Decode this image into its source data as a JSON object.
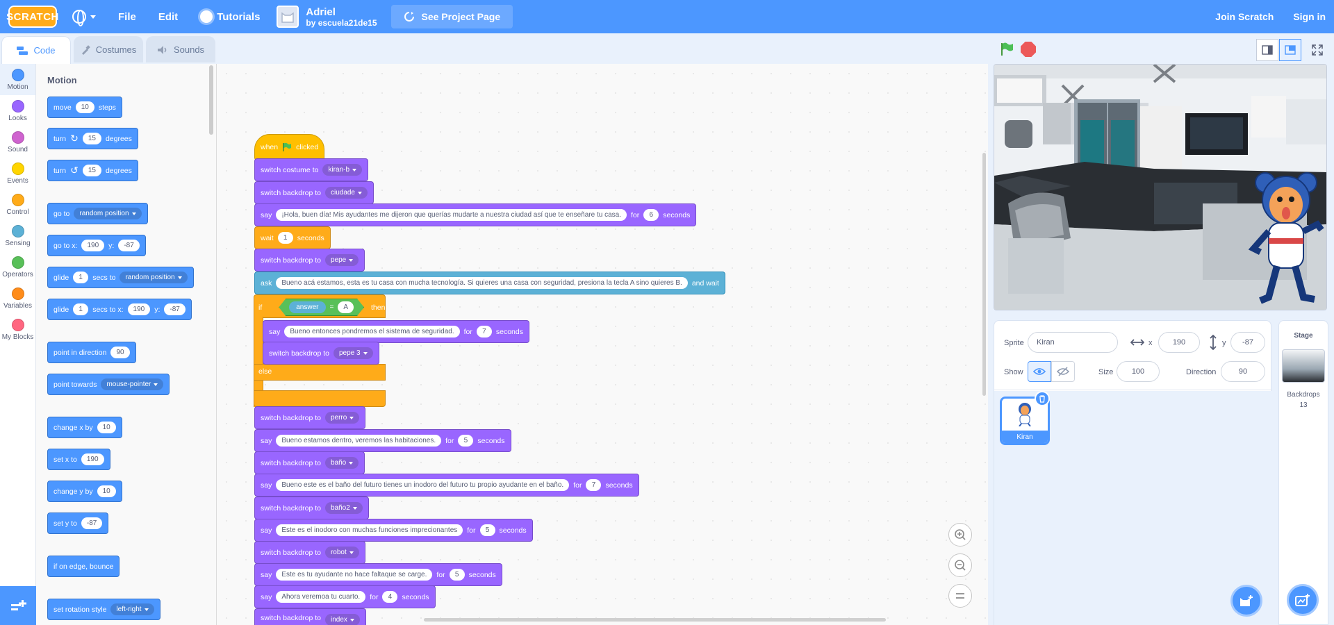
{
  "menubar": {
    "logo": "SCRATCH",
    "file": "File",
    "edit": "Edit",
    "tutorials": "Tutorials",
    "project_title": "Adriel",
    "project_author": "by escuela21de15",
    "see_project": "See Project Page",
    "join": "Join Scratch",
    "signin": "Sign in"
  },
  "tabs": {
    "code": "Code",
    "costumes": "Costumes",
    "sounds": "Sounds"
  },
  "categories": [
    {
      "label": "Motion",
      "color": "#4c97ff"
    },
    {
      "label": "Looks",
      "color": "#9966ff"
    },
    {
      "label": "Sound",
      "color": "#cf63cf"
    },
    {
      "label": "Events",
      "color": "#ffd500"
    },
    {
      "label": "Control",
      "color": "#ffab19"
    },
    {
      "label": "Sensing",
      "color": "#5cb1d6"
    },
    {
      "label": "Operators",
      "color": "#59c059"
    },
    {
      "label": "Variables",
      "color": "#ff8c1a"
    },
    {
      "label": "My Blocks",
      "color": "#ff6680"
    }
  ],
  "palette": {
    "title": "Motion",
    "move": {
      "a": "move",
      "v": "10",
      "b": "steps"
    },
    "turn_right": {
      "a": "turn",
      "v": "15",
      "b": "degrees"
    },
    "turn_left": {
      "a": "turn",
      "v": "15",
      "b": "degrees"
    },
    "goto": {
      "a": "go to",
      "d": "random position"
    },
    "gotoxy": {
      "a": "go to x:",
      "x": "190",
      "b": "y:",
      "y": "-87"
    },
    "glide_to": {
      "a": "glide",
      "v": "1",
      "b": "secs to",
      "d": "random position"
    },
    "glide_xy": {
      "a": "glide",
      "v": "1",
      "b": "secs to x:",
      "x": "190",
      "c": "y:",
      "y": "-87"
    },
    "point_dir": {
      "a": "point in direction",
      "v": "90"
    },
    "point_towards": {
      "a": "point towards",
      "d": "mouse-pointer"
    },
    "change_x": {
      "a": "change x by",
      "v": "10"
    },
    "set_x": {
      "a": "set x to",
      "v": "190"
    },
    "change_y": {
      "a": "change y by",
      "v": "10"
    },
    "set_y": {
      "a": "set y to",
      "v": "-87"
    },
    "bounce": {
      "a": "if on edge, bounce"
    },
    "rot_style": {
      "a": "set rotation style",
      "d": "left-right"
    }
  },
  "script": {
    "when_flag": {
      "a": "when",
      "b": "clicked"
    },
    "b1": {
      "a": "switch costume to",
      "d": "kiran-b"
    },
    "b2": {
      "a": "switch backdrop to",
      "d": "ciudade"
    },
    "b3": {
      "a": "say",
      "msg": "¡Hola, buen día! Mis ayudantes me dijeron que querías mudarte a nuestra ciudad así que te enseñare tu casa.",
      "for": "for",
      "v": "6",
      "b": "seconds"
    },
    "b4": {
      "a": "wait",
      "v": "1",
      "b": "seconds"
    },
    "b5": {
      "a": "switch backdrop to",
      "d": "pepe"
    },
    "b6": {
      "a": "ask",
      "msg": "Bueno acá estamos, esta  es tu casa con mucha tecnología. Si quieres una casa con seguridad, presiona la tecla  A sino quieres B.",
      "b": "and wait"
    },
    "if": {
      "a": "if",
      "answer": "answer",
      "eq": "=",
      "v": "A",
      "then": "then",
      "else": "else"
    },
    "b7": {
      "a": "say",
      "msg": "Bueno entonces pondremos el sistema de seguridad.",
      "for": "for",
      "v": "7",
      "b": "seconds"
    },
    "b8": {
      "a": "switch backdrop to",
      "d": "pepe 3"
    },
    "b9": {
      "a": "switch backdrop to",
      "d": "perro"
    },
    "b10": {
      "a": "say",
      "msg": "Bueno estamos dentro, veremos las habitaciones.",
      "for": "for",
      "v": "5",
      "b": "seconds"
    },
    "b11": {
      "a": "switch backdrop to",
      "d": "baño"
    },
    "b12": {
      "a": "say",
      "msg": "Bueno este es el baño del futuro tienes un inodoro del futuro tu propio ayudante en el baño.",
      "for": "for",
      "v": "7",
      "b": "seconds"
    },
    "b13": {
      "a": "switch backdrop to",
      "d": "baño2"
    },
    "b14": {
      "a": "say",
      "msg": "Este es el inodoro con muchas funciones imprecionantes",
      "for": "for",
      "v": "5",
      "b": "seconds"
    },
    "b15": {
      "a": "switch backdrop to",
      "d": "robot"
    },
    "b16": {
      "a": "say",
      "msg": "Este es tu ayudante no hace faltaque se carge.",
      "for": "for",
      "v": "5",
      "b": "seconds"
    },
    "b17": {
      "a": "say",
      "msg": "Ahora veremoa tu cuarto.",
      "for": "for",
      "v": "4",
      "b": "seconds"
    },
    "b18": {
      "a": "switch backdrop to",
      "d": "index"
    }
  },
  "sprite_info": {
    "sprite_label": "Sprite",
    "sprite_name": "Kiran",
    "x_label": "x",
    "x": "190",
    "y_label": "y",
    "y": "-87",
    "show_label": "Show",
    "size_label": "Size",
    "size": "100",
    "direction_label": "Direction",
    "direction": "90"
  },
  "sprites": [
    {
      "name": "Kiran"
    }
  ],
  "stage_pane": {
    "title": "Stage",
    "backdrops_label": "Backdrops",
    "backdrops_count": "13"
  },
  "colors": {
    "motion": "#4c97ff",
    "looks": "#9966ff",
    "events": "#ffbf00",
    "control": "#ffab19",
    "sensing": "#5cb1d6",
    "operators": "#59c059"
  }
}
